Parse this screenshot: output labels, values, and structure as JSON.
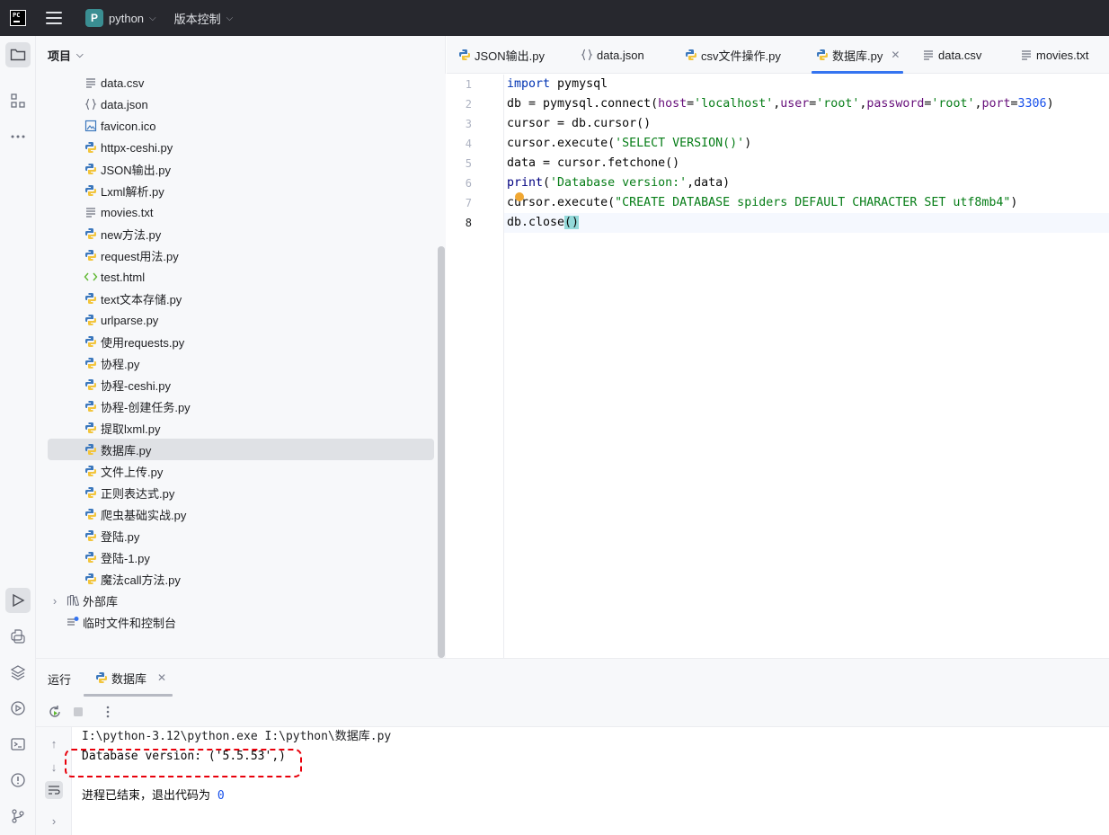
{
  "titlebar": {
    "logo_text": "PC",
    "project_badge": "P",
    "project_name": "python",
    "vcs_label": "版本控制"
  },
  "project_panel": {
    "title": "项目",
    "items": [
      {
        "label": "data.csv",
        "icon": "text-file-icon"
      },
      {
        "label": "data.json",
        "icon": "json-file-icon"
      },
      {
        "label": "favicon.ico",
        "icon": "image-file-icon"
      },
      {
        "label": "httpx-ceshi.py",
        "icon": "python-file-icon"
      },
      {
        "label": "JSON输出.py",
        "icon": "python-file-icon"
      },
      {
        "label": "Lxml解析.py",
        "icon": "python-file-icon"
      },
      {
        "label": "movies.txt",
        "icon": "text-file-icon"
      },
      {
        "label": "new方法.py",
        "icon": "python-file-icon"
      },
      {
        "label": "request用法.py",
        "icon": "python-file-icon"
      },
      {
        "label": "test.html",
        "icon": "html-file-icon"
      },
      {
        "label": "text文本存储.py",
        "icon": "python-file-icon"
      },
      {
        "label": "urlparse.py",
        "icon": "python-file-icon"
      },
      {
        "label": "使用requests.py",
        "icon": "python-file-icon"
      },
      {
        "label": "协程.py",
        "icon": "python-file-icon"
      },
      {
        "label": "协程-ceshi.py",
        "icon": "python-file-icon"
      },
      {
        "label": "协程-创建任务.py",
        "icon": "python-file-icon"
      },
      {
        "label": "提取lxml.py",
        "icon": "python-file-icon"
      },
      {
        "label": "数据库.py",
        "icon": "python-file-icon"
      },
      {
        "label": "文件上传.py",
        "icon": "python-file-icon"
      },
      {
        "label": "正则表达式.py",
        "icon": "python-file-icon"
      },
      {
        "label": "爬虫基础实战.py",
        "icon": "python-file-icon"
      },
      {
        "label": "登陆.py",
        "icon": "python-file-icon"
      },
      {
        "label": "登陆-1.py",
        "icon": "python-file-icon"
      },
      {
        "label": "魔法call方法.py",
        "icon": "python-file-icon"
      }
    ],
    "selected_item": "数据库.py",
    "external_libs": "外部库",
    "scratches": "临时文件和控制台"
  },
  "editor_tabs": [
    {
      "label": "JSON输出.py",
      "icon": "python-file-icon"
    },
    {
      "label": "data.json",
      "icon": "json-file-icon"
    },
    {
      "label": "csv文件操作.py",
      "icon": "python-file-icon"
    },
    {
      "label": "数据库.py",
      "icon": "python-file-icon",
      "active": true
    },
    {
      "label": "data.csv",
      "icon": "text-file-icon"
    },
    {
      "label": "movies.txt",
      "icon": "text-file-icon"
    }
  ],
  "editor": {
    "line_numbers": [
      "1",
      "2",
      "3",
      "4",
      "5",
      "6",
      "7",
      "8"
    ],
    "current_line": "8",
    "code": {
      "l1_kw": "import",
      "l1_rest": " pymysql",
      "l2_a": "db = pymysql.connect(",
      "l2_p1": "host",
      "l2_eq1": "=",
      "l2_s1": "'localhost'",
      "l2_c1": ",",
      "l2_p2": "user",
      "l2_eq2": "=",
      "l2_s2": "'root'",
      "l2_c2": ",",
      "l2_p3": "password",
      "l2_eq3": "=",
      "l2_s3": "'root'",
      "l2_c3": ",",
      "l2_p4": "port",
      "l2_eq4": "=",
      "l2_n4": "3306",
      "l2_end": ")",
      "l3": "cursor = db.cursor()",
      "l4_a": "cursor.execute(",
      "l4_s": "'SELECT VERSION()'",
      "l4_end": ")",
      "l5": "data = cursor.fetchone()",
      "l6_bi": "print",
      "l6_a": "(",
      "l6_s": "'Database version:'",
      "l6_end": ",data)",
      "l7_a": "cursor.execute(",
      "l7_s": "\"CREATE DATABASE spiders DEFAULT CHARACTER SET utf8mb4\"",
      "l7_end": ")",
      "l8_a": "db.close",
      "l8_brace": "()"
    }
  },
  "run_panel": {
    "title": "运行",
    "tab_label": "数据库",
    "console": {
      "command": "I:\\python-3.12\\python.exe I:\\python\\数据库.py",
      "output": "Database version: ('5.5.53',)",
      "exit_text": "进程已结束，退出代码为 ",
      "exit_code": "0"
    }
  },
  "colors": {
    "accent": "#3574f0",
    "annotation": "#e8000b",
    "titlebar": "#27282e"
  }
}
